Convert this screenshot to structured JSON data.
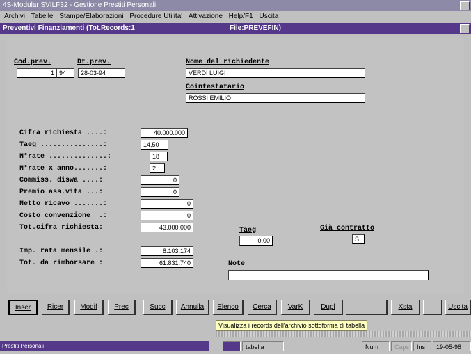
{
  "app": {
    "title": "4S-Modular SVILF32 - Gestione Prestiti Personali"
  },
  "menu": [
    "Archivi",
    "Tabelle",
    "Stampe/Elaborazioni",
    "Procedure Utilita'",
    "Attivazione",
    "Help/F1",
    "Uscita"
  ],
  "document": {
    "title": "Preventivi Finanziamenti (Tot.Records:1",
    "file": "File:PREVEFIN)"
  },
  "form": {
    "cod_prev_label": "Cod.prev.",
    "cod_prev_value1": "1",
    "cod_prev_value2": "94",
    "dt_prev_label": "Dt.prev.",
    "dt_prev_value": "28-03-94",
    "richiedente_label": "Nome del richiedente",
    "richiedente_value": "VERDI LUIGI",
    "cointestatario_label": "Cointestatario",
    "cointestatario_value": "ROSSI EMILIO",
    "rows": [
      {
        "label": "Cifra richiesta ....:",
        "value": "40.000.000"
      },
      {
        "label": "Taeg ...............:",
        "value": "14,50"
      },
      {
        "label": "N°rate ..............:",
        "value": "18"
      },
      {
        "label": "N°rate x anno.......:",
        "value": "2"
      },
      {
        "label": "Commiss. diswa ....:",
        "value": "0"
      },
      {
        "label": "Premio ass.vita ...:",
        "value": "0"
      },
      {
        "label": "Netto ricavo .......:",
        "value": "0"
      },
      {
        "label": "Costo convenzione  .:",
        "value": "0"
      },
      {
        "label": "Tot.cifra richiesta:",
        "value": "43.000.000"
      }
    ],
    "taeg_label": "Taeg",
    "taeg_value": "0,00",
    "contratto_label": "Già contratto",
    "contratto_value": "S",
    "rata_label": "Imp. rata mensile .:",
    "rata_value": "8.103.174",
    "rimborsare_label": "Tot. da rimborsare :",
    "rimborsare_value": "61.831.740",
    "note_label": "Note",
    "note_value": ""
  },
  "buttons": [
    "Inser",
    "Ricer",
    "Modif",
    "Prec",
    "Succ",
    "Annulla",
    "Elenco",
    "Cerca",
    "VarK",
    "Dupl",
    "",
    "Xsta",
    "",
    "Uscita"
  ],
  "tooltip": "Visualizza i records dell'archivio sottoforma di tabella",
  "statusbar": {
    "left": "Prestiti Personali",
    "task": "tabella",
    "num": "Num",
    "caps": "Caps",
    "ins": "Ins",
    "date": "19-05-98"
  },
  "colors": {
    "title_bar": "#55388a",
    "app_title_bar": "#8c8aa6",
    "face": "#c0c0c0",
    "tooltip_bg": "#ffffc0"
  }
}
